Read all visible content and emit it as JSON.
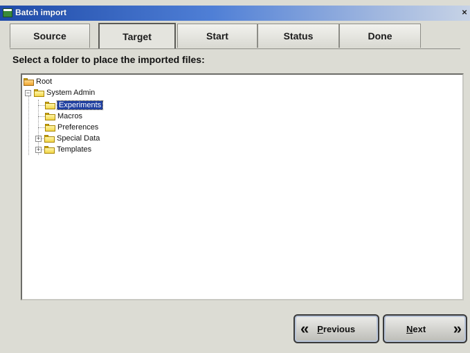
{
  "window": {
    "title": "Batch import",
    "close_glyph": "×"
  },
  "tabs": [
    {
      "label": "Source",
      "active": false
    },
    {
      "label": "Target",
      "active": true
    },
    {
      "label": "Start",
      "active": false
    },
    {
      "label": "Status",
      "active": false
    },
    {
      "label": "Done",
      "active": false
    }
  ],
  "prompt": "Select a folder to place the imported files:",
  "tree": {
    "root": {
      "label": "Root",
      "icon": "open-folder-icon"
    },
    "system_admin": {
      "label": "System Admin",
      "expander": "−",
      "icon": "folder-icon"
    },
    "experiments": {
      "label": "Experiments",
      "selected": true,
      "icon": "folder-icon"
    },
    "macros": {
      "label": "Macros",
      "icon": "folder-icon"
    },
    "preferences": {
      "label": "Preferences",
      "icon": "folder-icon"
    },
    "special_data": {
      "label": "Special Data",
      "expander": "+",
      "icon": "folder-icon"
    },
    "templates": {
      "label": "Templates",
      "expander": "+",
      "icon": "folder-icon"
    }
  },
  "buttons": {
    "previous": {
      "label_first": "P",
      "label_rest": "revious",
      "icon": "double-chevron-left-icon",
      "glyph": "«"
    },
    "next": {
      "label_first": "N",
      "label_rest": "ext",
      "icon": "double-chevron-right-icon",
      "glyph": "»"
    }
  }
}
